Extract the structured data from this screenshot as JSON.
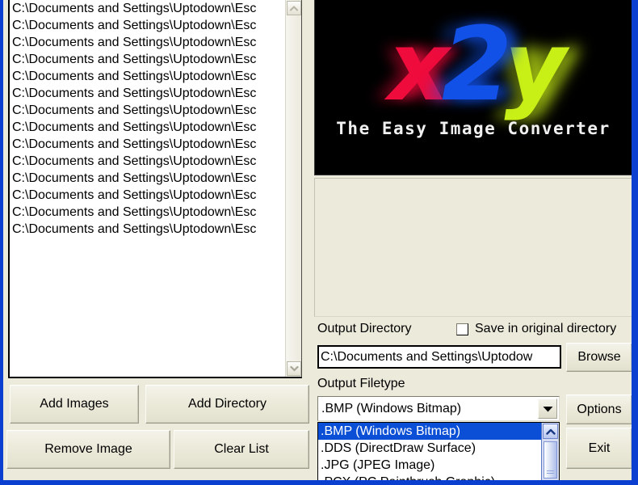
{
  "window": {
    "frame_color": "#0a3fd0",
    "background_color": "#eceadb"
  },
  "file_list": {
    "items": [
      "C:\\Documents and Settings\\Uptodown\\Esc",
      "C:\\Documents and Settings\\Uptodown\\Esc",
      "C:\\Documents and Settings\\Uptodown\\Esc",
      "C:\\Documents and Settings\\Uptodown\\Esc",
      "C:\\Documents and Settings\\Uptodown\\Esc",
      "C:\\Documents and Settings\\Uptodown\\Esc",
      "C:\\Documents and Settings\\Uptodown\\Esc",
      "C:\\Documents and Settings\\Uptodown\\Esc",
      "C:\\Documents and Settings\\Uptodown\\Esc",
      "C:\\Documents and Settings\\Uptodown\\Esc",
      "C:\\Documents and Settings\\Uptodown\\Esc",
      "C:\\Documents and Settings\\Uptodown\\Esc",
      "C:\\Documents and Settings\\Uptodown\\Esc",
      "C:\\Documents and Settings\\Uptodown\\Esc"
    ],
    "scrollbar": {
      "up_icon": "chevron-up-icon",
      "down_icon": "chevron-down-icon"
    }
  },
  "buttons": {
    "add_images": "Add Images",
    "add_directory": "Add Directory",
    "remove_image": "Remove Image",
    "clear_list": "Clear List",
    "browse": "Browse",
    "options": "Options",
    "exit": "Exit"
  },
  "logo": {
    "letter_x": "x",
    "letter_2": "2",
    "letter_y": "y",
    "tagline": "The Easy Image Converter",
    "color_x": "#ef0b3c",
    "color_2": "#1151e8",
    "color_y": "#c8ef16",
    "background": "#000000"
  },
  "output_directory": {
    "label": "Output Directory",
    "value": "C:\\Documents and Settings\\Uptodow",
    "save_in_original_label": "Save in original directory",
    "save_in_original_checked": false
  },
  "output_filetype": {
    "label": "Output Filetype",
    "selected": ".BMP (Windows Bitmap)",
    "dropdown_open": true,
    "options": [
      ".BMP (Windows Bitmap)",
      ".DDS (DirectDraw Surface)",
      ".JPG (JPEG Image)",
      ".PCX (PC Paintbrush Graphic)"
    ],
    "selected_index": 0,
    "highlight_color": "#0a4fd5",
    "arrow_icon": "chevron-down-icon",
    "scroll_up_icon": "chevron-up-icon"
  }
}
